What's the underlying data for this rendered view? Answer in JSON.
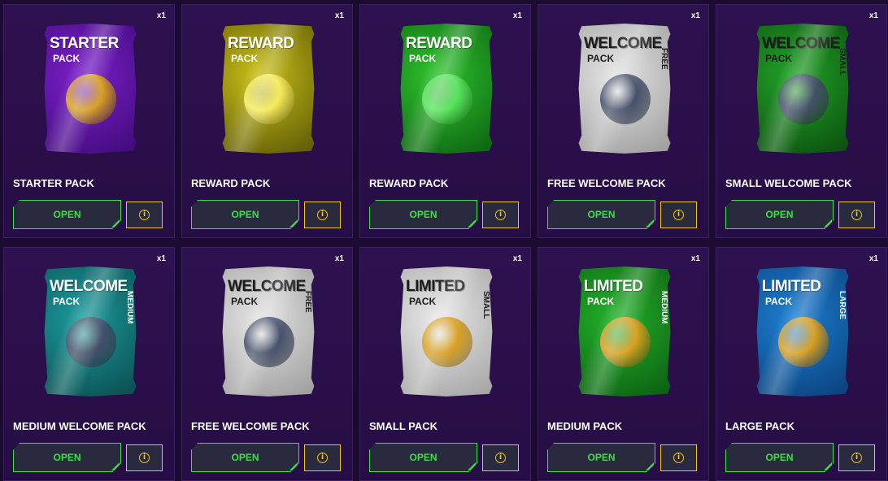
{
  "packs": [
    {
      "title": "STARTER PACK",
      "qty": "x1",
      "open_label": "OPEN",
      "art_line1": "STARTER",
      "art_line2": "PACK",
      "art_side": "",
      "bg": "#7a1fc9",
      "bg2": "#3e0a78",
      "text": "#ffffff",
      "emblem": "#d8a021",
      "icon": "football-icon"
    },
    {
      "title": "REWARD PACK",
      "qty": "x1",
      "open_label": "OPEN",
      "art_line1": "REWARD",
      "art_line2": "PACK",
      "art_side": "",
      "bg": "#c8c018",
      "bg2": "#5a5406",
      "text": "#ffffff",
      "emblem": "#f6ea5a",
      "icon": "lightbulb-icon"
    },
    {
      "title": "REWARD PACK",
      "qty": "x1",
      "open_label": "OPEN",
      "art_line1": "REWARD",
      "art_line2": "PACK",
      "art_side": "",
      "bg": "#2fc32d",
      "bg2": "#0b5f10",
      "text": "#ffffff",
      "emblem": "#55e55a",
      "icon": "reward-icon"
    },
    {
      "title": "FREE WELCOME PACK",
      "qty": "x1",
      "open_label": "OPEN",
      "art_line1": "WELCOME",
      "art_line2": "PACK",
      "art_side": "FREE",
      "bg": "#e4e4e4",
      "bg2": "#9a9a9a",
      "text": "#1b1b1b",
      "emblem": "#45506a",
      "icon": "mascot-icon"
    },
    {
      "title": "SMALL WELCOME PACK",
      "qty": "x1",
      "open_label": "OPEN",
      "art_line1": "WELCOME",
      "art_line2": "PACK",
      "art_side": "SMALL",
      "bg": "#23a229",
      "bg2": "#0a4b0d",
      "text": "#1b1b1b",
      "emblem": "#45506a",
      "icon": "mascot-icon"
    },
    {
      "title": "MEDIUM WELCOME PACK",
      "qty": "x1",
      "open_label": "OPEN",
      "art_line1": "WELCOME",
      "art_line2": "PACK",
      "art_side": "MEDIUM",
      "bg": "#1c9a9c",
      "bg2": "#0a4a4c",
      "text": "#ffffff",
      "emblem": "#45506a",
      "icon": "mascot-icon"
    },
    {
      "title": "FREE WELCOME PACK",
      "qty": "x1",
      "open_label": "OPEN",
      "art_line1": "WELCOME",
      "art_line2": "PACK",
      "art_side": "FREE",
      "bg": "#e4e4e4",
      "bg2": "#9a9a9a",
      "text": "#1b1b1b",
      "emblem": "#45506a",
      "icon": "mascot-icon"
    },
    {
      "title": "SMALL PACK",
      "qty": "x1",
      "open_label": "OPEN",
      "art_line1": "LIMITED",
      "art_line2": "PACK",
      "art_side": "SMALL",
      "bg": "#e8e8e8",
      "bg2": "#a0a0a0",
      "text": "#1b1b1b",
      "emblem": "#d9a020",
      "icon": "football-icon"
    },
    {
      "title": "MEDIUM PACK",
      "qty": "x1",
      "open_label": "OPEN",
      "art_line1": "LIMITED",
      "art_line2": "PACK",
      "art_side": "MEDIUM",
      "bg": "#24b22b",
      "bg2": "#0b5a10",
      "text": "#ffffff",
      "emblem": "#d9a020",
      "icon": "football-icon"
    },
    {
      "title": "LARGE PACK",
      "qty": "x1",
      "open_label": "OPEN",
      "art_line1": "LIMITED",
      "art_line2": "PACK",
      "art_side": "LARGE",
      "bg": "#1d7fd1",
      "bg2": "#0a3d78",
      "text": "#ffffff",
      "emblem": "#d9a020",
      "icon": "football-icon"
    }
  ],
  "info_glyph": "i",
  "colors": {
    "accent_green": "#3ce146",
    "accent_yellow": "#f0c418",
    "card_bg": "#2e1150"
  }
}
